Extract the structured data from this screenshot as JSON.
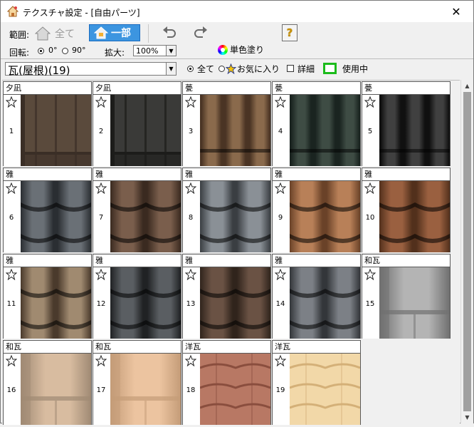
{
  "window": {
    "title": "テクスチャ設定 - [自由パーツ]"
  },
  "toolbar": {
    "scope_label": "範囲:",
    "scope_all_label": "全て",
    "scope_part_label": "一部",
    "rotate_label": "回転:",
    "rotate_0": "0°",
    "rotate_90": "90°",
    "rotate_selected": "0°",
    "zoom_label": "拡大:",
    "zoom_value": "100%",
    "help_glyph": "?",
    "mono_paint_label": "単色塗り"
  },
  "filter": {
    "category_value": "瓦(屋根)(19)",
    "all_label": "全て",
    "favorites_label": "お気に入り",
    "detail_label": "詳細",
    "detail_checked": false,
    "in_use_label": "使用中",
    "in_use_color": "#1bbb1b"
  },
  "textures": [
    {
      "name": "夕凪",
      "num": "1",
      "style": "flat-brown"
    },
    {
      "name": "夕凪",
      "num": "2",
      "style": "flat-dark"
    },
    {
      "name": "甍",
      "num": "3",
      "style": "rib-brown"
    },
    {
      "name": "甍",
      "num": "4",
      "style": "rib-green"
    },
    {
      "name": "甍",
      "num": "5",
      "style": "rib-black"
    },
    {
      "name": "雅",
      "num": "6",
      "style": "wave-slate"
    },
    {
      "name": "雅",
      "num": "7",
      "style": "wave-brown"
    },
    {
      "name": "雅",
      "num": "8",
      "style": "wave-gray"
    },
    {
      "name": "雅",
      "num": "9",
      "style": "wave-orange"
    },
    {
      "name": "雅",
      "num": "10",
      "style": "wave-rust"
    },
    {
      "name": "雅",
      "num": "11",
      "style": "wave-tan"
    },
    {
      "name": "雅",
      "num": "12",
      "style": "wave-charcoal"
    },
    {
      "name": "雅",
      "num": "13",
      "style": "wave-umber"
    },
    {
      "name": "雅",
      "num": "14",
      "style": "wave-steel"
    },
    {
      "name": "和瓦",
      "num": "15",
      "style": "jp-silver"
    },
    {
      "name": "和瓦",
      "num": "16",
      "style": "jp-beige"
    },
    {
      "name": "和瓦",
      "num": "17",
      "style": "jp-peach"
    },
    {
      "name": "洋瓦",
      "num": "18",
      "style": "west-red"
    },
    {
      "name": "洋瓦",
      "num": "19",
      "style": "west-cream"
    }
  ]
}
